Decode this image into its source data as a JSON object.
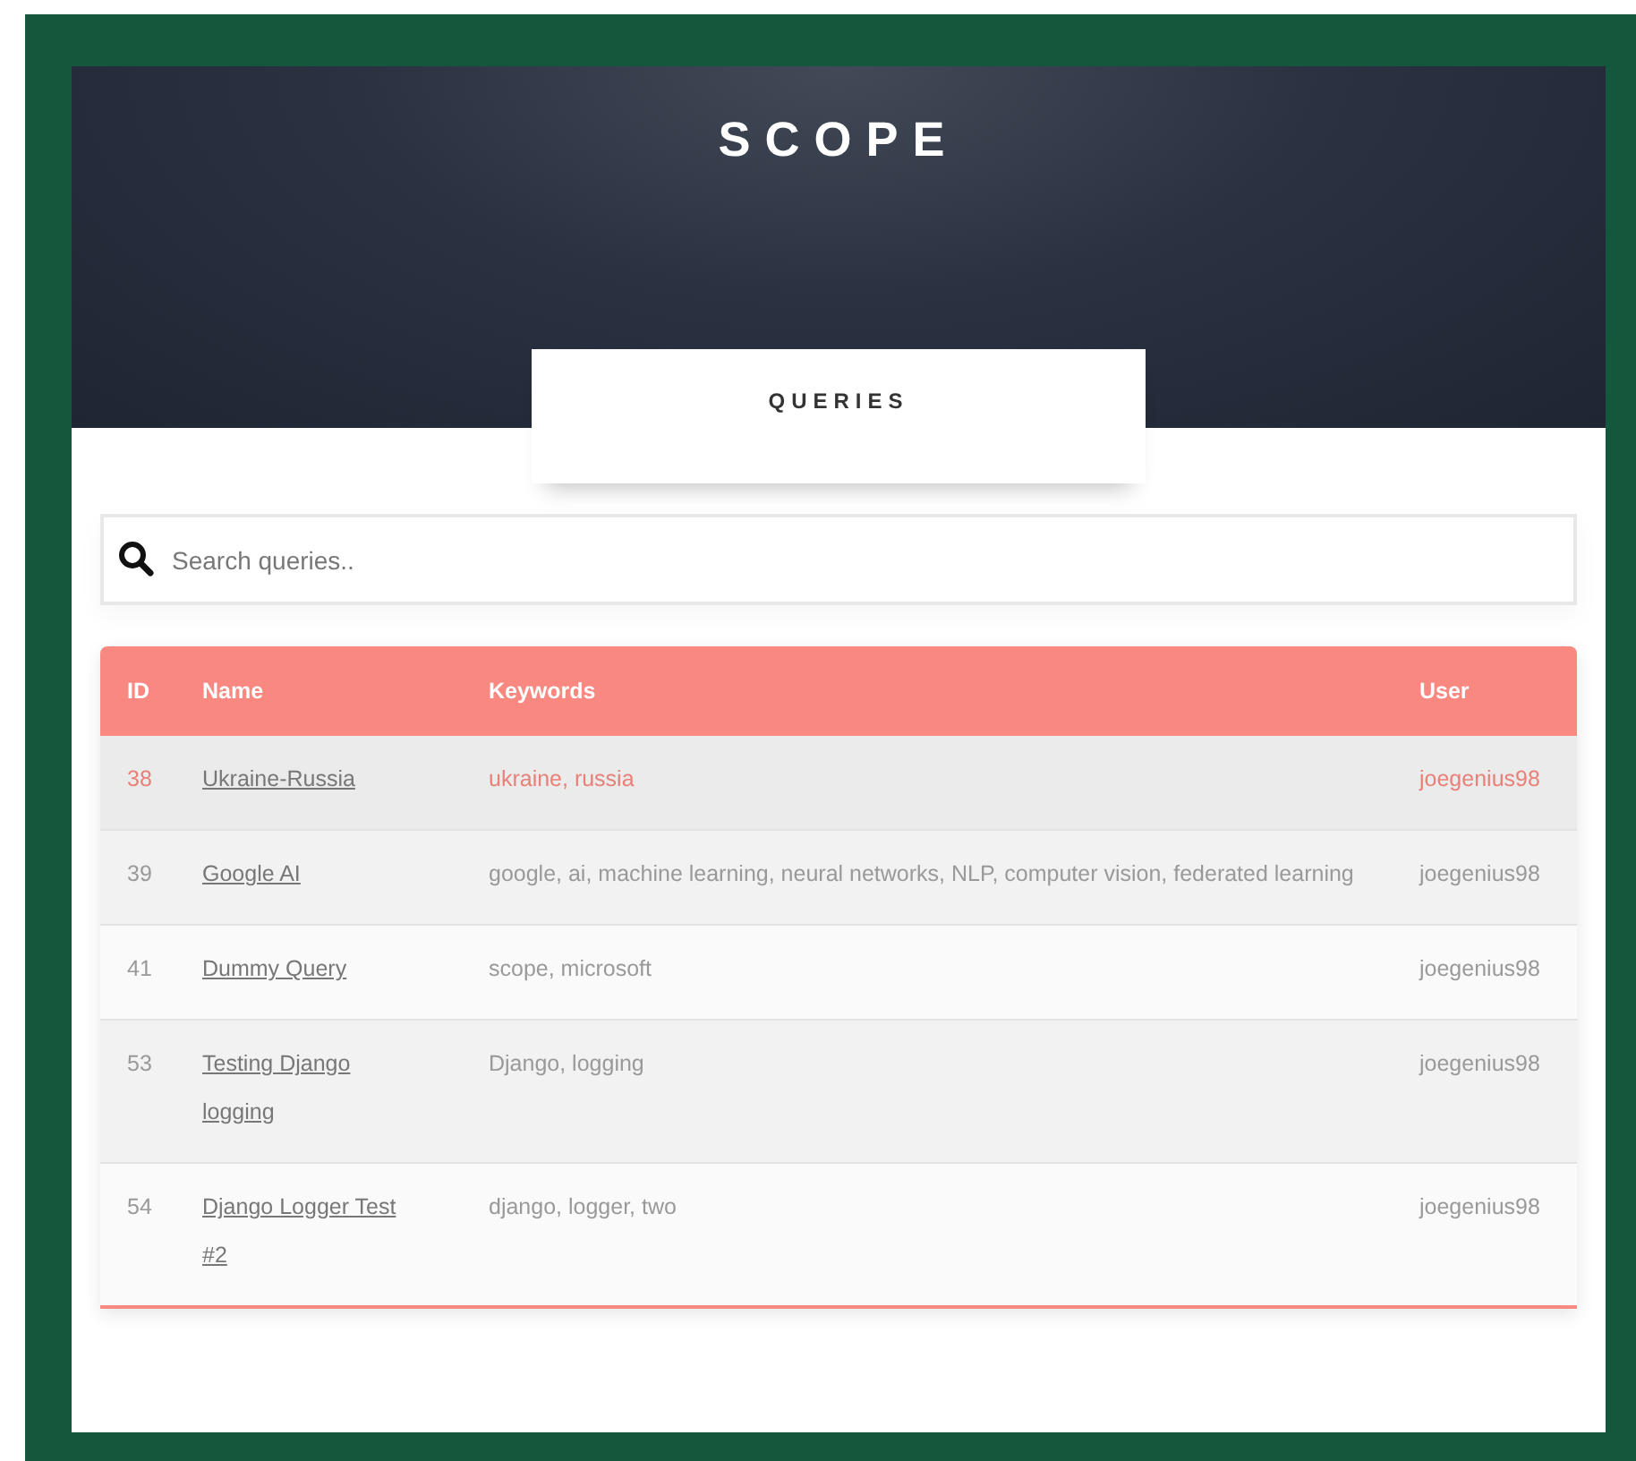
{
  "header": {
    "title": "SCOPE"
  },
  "tabs": [
    {
      "label": "QUERIES",
      "selected": true
    }
  ],
  "search": {
    "placeholder": "Search queries.."
  },
  "table": {
    "columns": [
      "ID",
      "Name",
      "Keywords",
      "User"
    ],
    "rows": [
      {
        "id": "38",
        "name": "Ukraine-Russia",
        "keywords": "ukraine, russia",
        "user": "joegenius98",
        "selected": true
      },
      {
        "id": "39",
        "name": "Google AI",
        "keywords": "google, ai, machine learning, neural networks, NLP, computer vision, federated learning",
        "user": "joegenius98",
        "selected": false
      },
      {
        "id": "41",
        "name": "Dummy Query",
        "keywords": "scope, microsoft",
        "user": "joegenius98",
        "selected": false
      },
      {
        "id": "53",
        "name": "Testing Django logging",
        "keywords": "Django, logging",
        "user": "joegenius98",
        "selected": false
      },
      {
        "id": "54",
        "name": "Django Logger Test #2",
        "keywords": "django, logger, two",
        "user": "joegenius98",
        "selected": false
      }
    ]
  }
}
